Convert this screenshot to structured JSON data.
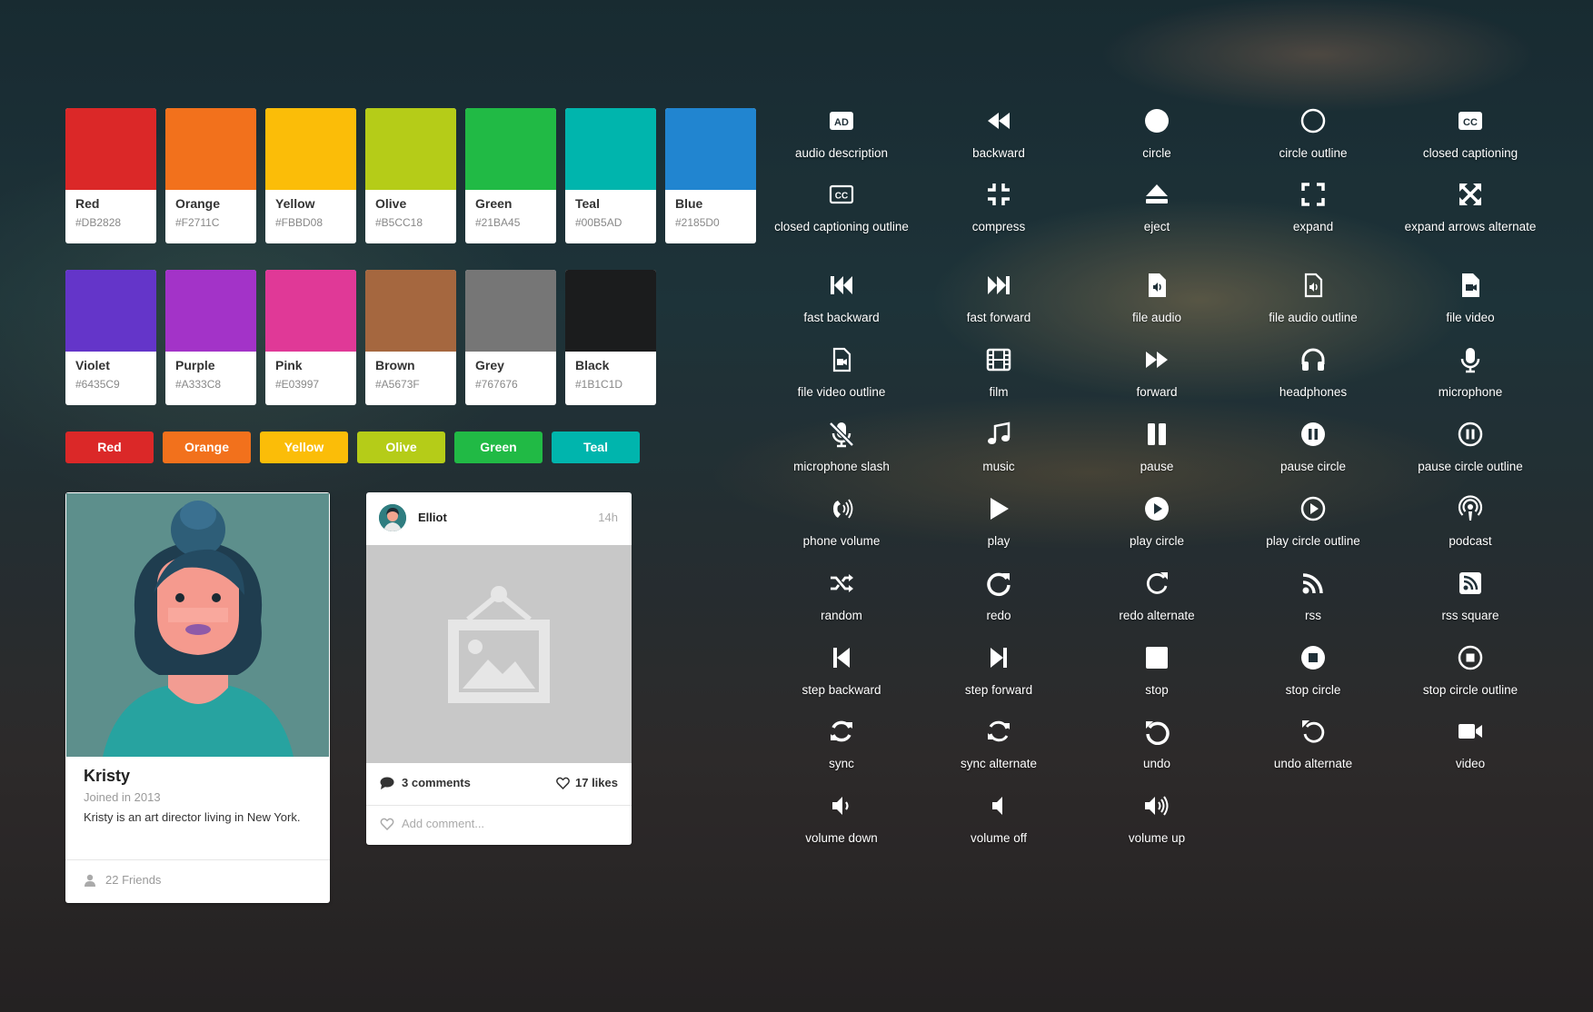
{
  "swatches": [
    {
      "name": "Red",
      "hex": "#DB2828"
    },
    {
      "name": "Orange",
      "hex": "#F2711C"
    },
    {
      "name": "Yellow",
      "hex": "#FBBD08"
    },
    {
      "name": "Olive",
      "hex": "#B5CC18"
    },
    {
      "name": "Green",
      "hex": "#21BA45"
    },
    {
      "name": "Teal",
      "hex": "#00B5AD"
    },
    {
      "name": "Blue",
      "hex": "#2185D0"
    },
    {
      "name": "Violet",
      "hex": "#6435C9"
    },
    {
      "name": "Purple",
      "hex": "#A333C8"
    },
    {
      "name": "Pink",
      "hex": "#E03997"
    },
    {
      "name": "Brown",
      "hex": "#A5673F"
    },
    {
      "name": "Grey",
      "hex": "#767676"
    },
    {
      "name": "Black",
      "hex": "#1B1C1D"
    }
  ],
  "buttons": [
    {
      "label": "Red",
      "color": "#DB2828"
    },
    {
      "label": "Orange",
      "color": "#F2711C"
    },
    {
      "label": "Yellow",
      "color": "#FBBD08"
    },
    {
      "label": "Olive",
      "color": "#B5CC18"
    },
    {
      "label": "Green",
      "color": "#21BA45"
    },
    {
      "label": "Teal",
      "color": "#00B5AD"
    }
  ],
  "profile": {
    "name": "Kristy",
    "joined": "Joined in 2013",
    "description": "Kristy is an art director living in New York.",
    "friends": "22 Friends"
  },
  "post": {
    "author": "Elliot",
    "time": "14h",
    "comments": "3 comments",
    "likes": "17 likes",
    "comment_placeholder": "Add comment..."
  },
  "icons": [
    {
      "id": "audio-description",
      "label": "audio description"
    },
    {
      "id": "backward",
      "label": "backward"
    },
    {
      "id": "circle",
      "label": "circle"
    },
    {
      "id": "circle-outline",
      "label": "circle outline"
    },
    {
      "id": "closed-captioning",
      "label": "closed captioning"
    },
    {
      "id": "closed-captioning-outline",
      "label": "closed captioning outline"
    },
    {
      "id": "compress",
      "label": "compress"
    },
    {
      "id": "eject",
      "label": "eject"
    },
    {
      "id": "expand",
      "label": "expand"
    },
    {
      "id": "expand-arrows-alternate",
      "label": "expand arrows alternate"
    },
    {
      "id": "fast-backward",
      "label": "fast backward"
    },
    {
      "id": "fast-forward",
      "label": "fast forward"
    },
    {
      "id": "file-audio",
      "label": "file audio"
    },
    {
      "id": "file-audio-outline",
      "label": "file audio outline"
    },
    {
      "id": "file-video",
      "label": "file video"
    },
    {
      "id": "file-video-outline",
      "label": "file video outline"
    },
    {
      "id": "film",
      "label": "film"
    },
    {
      "id": "forward",
      "label": "forward"
    },
    {
      "id": "headphones",
      "label": "headphones"
    },
    {
      "id": "microphone",
      "label": "microphone"
    },
    {
      "id": "microphone-slash",
      "label": "microphone slash"
    },
    {
      "id": "music",
      "label": "music"
    },
    {
      "id": "pause",
      "label": "pause"
    },
    {
      "id": "pause-circle",
      "label": "pause circle"
    },
    {
      "id": "pause-circle-outline",
      "label": "pause circle outline"
    },
    {
      "id": "phone-volume",
      "label": "phone volume"
    },
    {
      "id": "play",
      "label": "play"
    },
    {
      "id": "play-circle",
      "label": "play circle"
    },
    {
      "id": "play-circle-outline",
      "label": "play circle outline"
    },
    {
      "id": "podcast",
      "label": "podcast"
    },
    {
      "id": "random",
      "label": "random"
    },
    {
      "id": "redo",
      "label": "redo"
    },
    {
      "id": "redo-alternate",
      "label": "redo alternate"
    },
    {
      "id": "rss",
      "label": "rss"
    },
    {
      "id": "rss-square",
      "label": "rss square"
    },
    {
      "id": "step-backward",
      "label": "step backward"
    },
    {
      "id": "step-forward",
      "label": "step forward"
    },
    {
      "id": "stop",
      "label": "stop"
    },
    {
      "id": "stop-circle",
      "label": "stop circle"
    },
    {
      "id": "stop-circle-outline",
      "label": "stop circle outline"
    },
    {
      "id": "sync",
      "label": "sync"
    },
    {
      "id": "sync-alternate",
      "label": "sync alternate"
    },
    {
      "id": "undo",
      "label": "undo"
    },
    {
      "id": "undo-alternate",
      "label": "undo alternate"
    },
    {
      "id": "video",
      "label": "video"
    },
    {
      "id": "volume-down",
      "label": "volume down"
    },
    {
      "id": "volume-off",
      "label": "volume off"
    },
    {
      "id": "volume-up",
      "label": "volume up"
    }
  ]
}
